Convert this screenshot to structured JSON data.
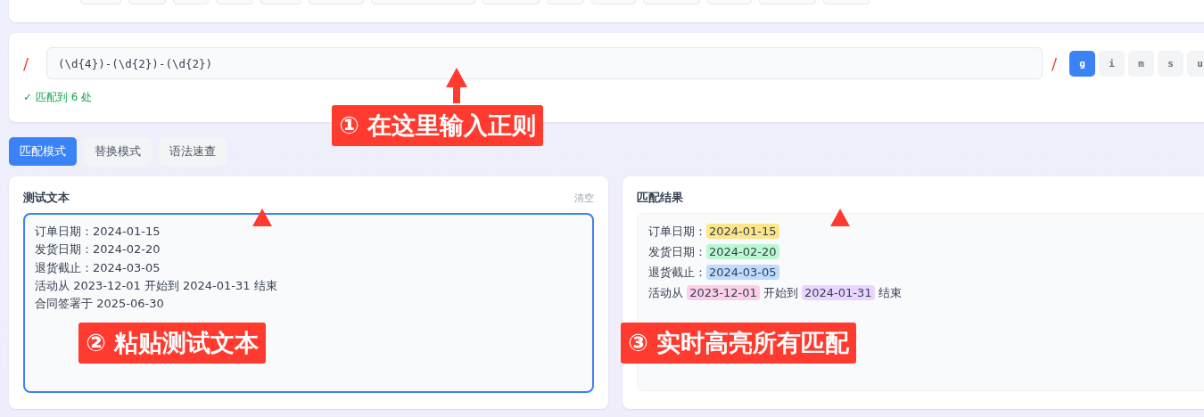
{
  "regex": {
    "open_slash": "/",
    "pattern": "(\\d{4})-(\\d{2})-(\\d{2})",
    "close_slash": "/",
    "flags": [
      {
        "label": "g",
        "selected": true
      },
      {
        "label": "i",
        "selected": false
      },
      {
        "label": "m",
        "selected": false
      },
      {
        "label": "s",
        "selected": false
      },
      {
        "label": "u",
        "selected": false
      }
    ],
    "status": "✓ 匹配到 6 处"
  },
  "tabs": [
    {
      "label": "匹配模式",
      "selected": true
    },
    {
      "label": "替换模式",
      "selected": false
    },
    {
      "label": "语法速查",
      "selected": false
    }
  ],
  "test_panel": {
    "title": "测试文本",
    "clear": "清空",
    "lines": [
      "订单日期：2024-01-15",
      "发货日期：2024-02-20",
      "退货截止：2024-03-05",
      "活动从 2023-12-01 开始到 2024-01-31 结束",
      "合同签署于 2025-06-30"
    ]
  },
  "result_panel": {
    "title": "匹配结果",
    "lines": [
      [
        {
          "text": "订单日期："
        },
        {
          "text": "2024-01-15",
          "color": "#fde68a"
        }
      ],
      [
        {
          "text": "发货日期："
        },
        {
          "text": "2024-02-20",
          "color": "#bbf7d0"
        }
      ],
      [
        {
          "text": "退货截止："
        },
        {
          "text": "2024-03-05",
          "color": "#bfdbfe"
        }
      ],
      [
        {
          "text": "活动从 "
        },
        {
          "text": "2023-12-01",
          "color": "#fbcfe8"
        },
        {
          "text": " 开始到 "
        },
        {
          "text": "2024-01-31",
          "color": "#e9d5ff"
        },
        {
          "text": " 结束"
        }
      ]
    ]
  },
  "annotations": [
    {
      "label": "① 在这里输入正则"
    },
    {
      "label": "② 粘贴测试文本"
    },
    {
      "label": "③ 实时高亮所有匹配"
    }
  ]
}
